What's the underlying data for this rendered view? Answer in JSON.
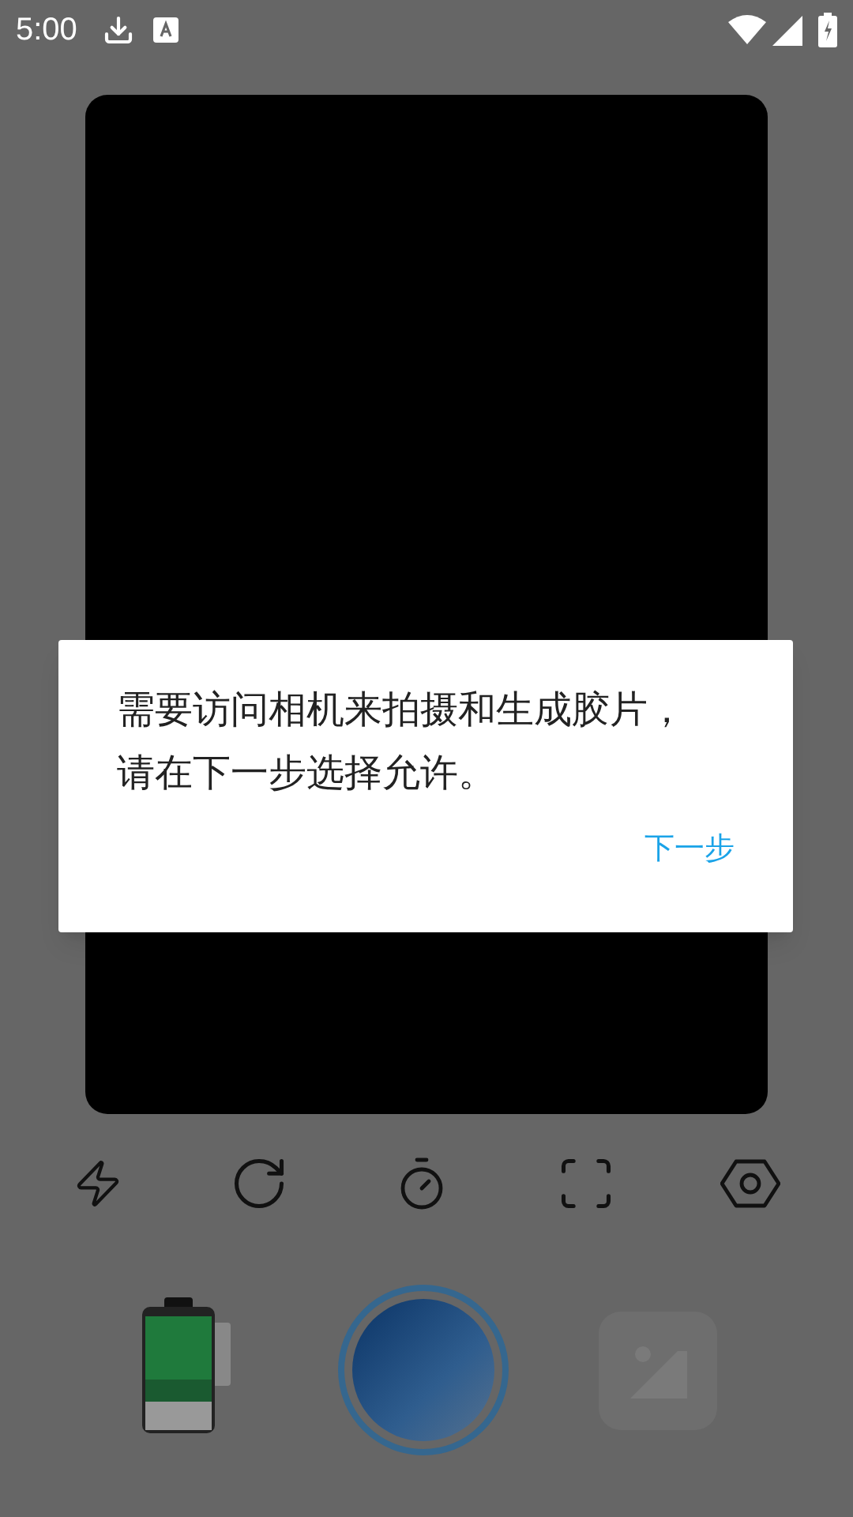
{
  "status_bar": {
    "time": "5:00"
  },
  "dialog": {
    "message": "需要访问相机来拍摄和生成胶片，请在下一步选择允许。",
    "button": "下一步"
  }
}
